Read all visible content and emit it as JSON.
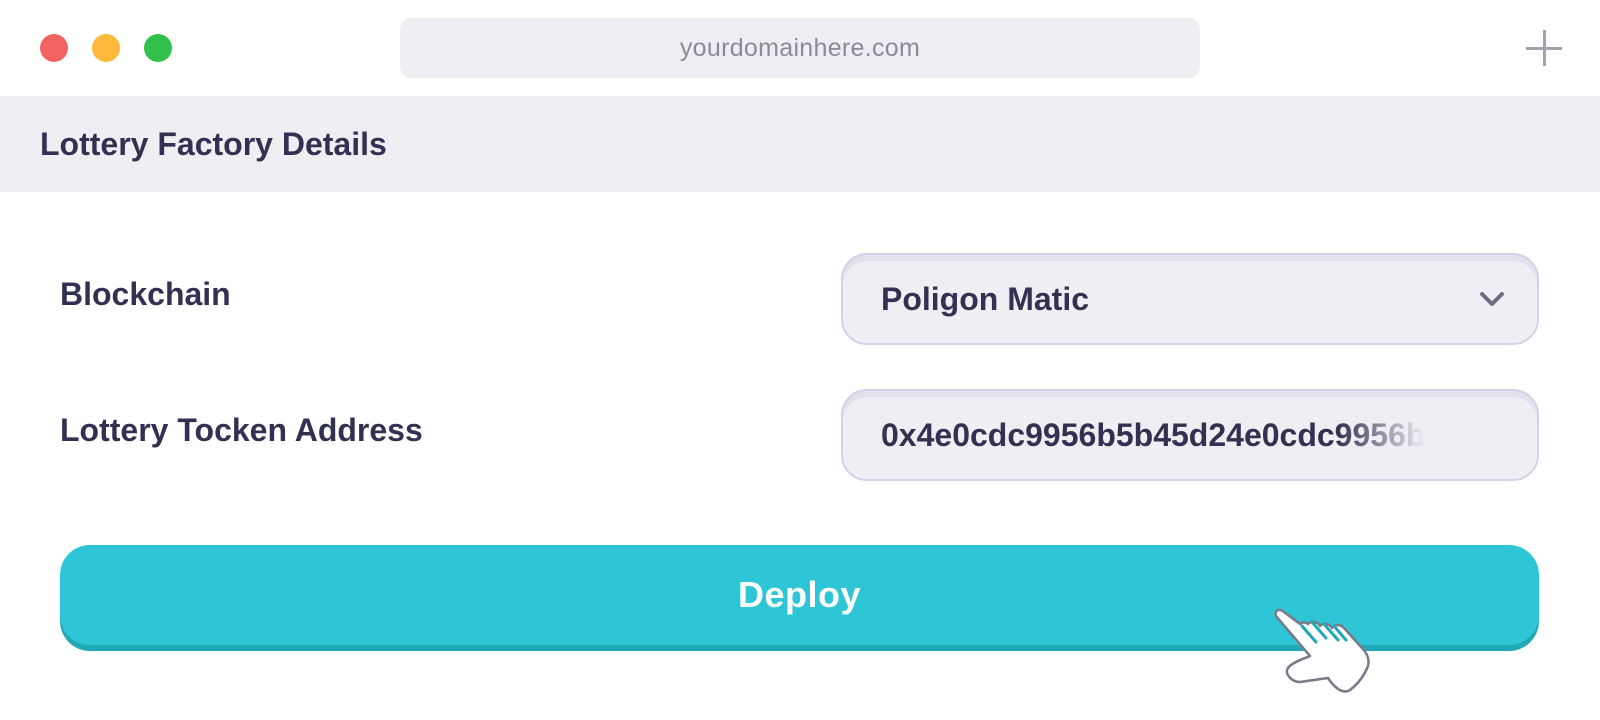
{
  "browser": {
    "url": "yourdomainhere.com"
  },
  "header": {
    "title": "Lottery Factory Details"
  },
  "form": {
    "blockchain": {
      "label": "Blockchain",
      "value": "Poligon Matic"
    },
    "token_address": {
      "label": "Lottery Tocken Address",
      "value": "0x4e0cdc9956b5b45d24e0cdc9956b"
    }
  },
  "actions": {
    "deploy_label": "Deploy"
  },
  "colors": {
    "accent": "#2ec6d6",
    "text_dark": "#333152",
    "panel": "#efeef3"
  },
  "icons": [
    "close-dot-icon",
    "minimize-dot-icon",
    "maximize-dot-icon",
    "plus-icon",
    "chevron-down-icon",
    "hand-cursor-icon"
  ]
}
